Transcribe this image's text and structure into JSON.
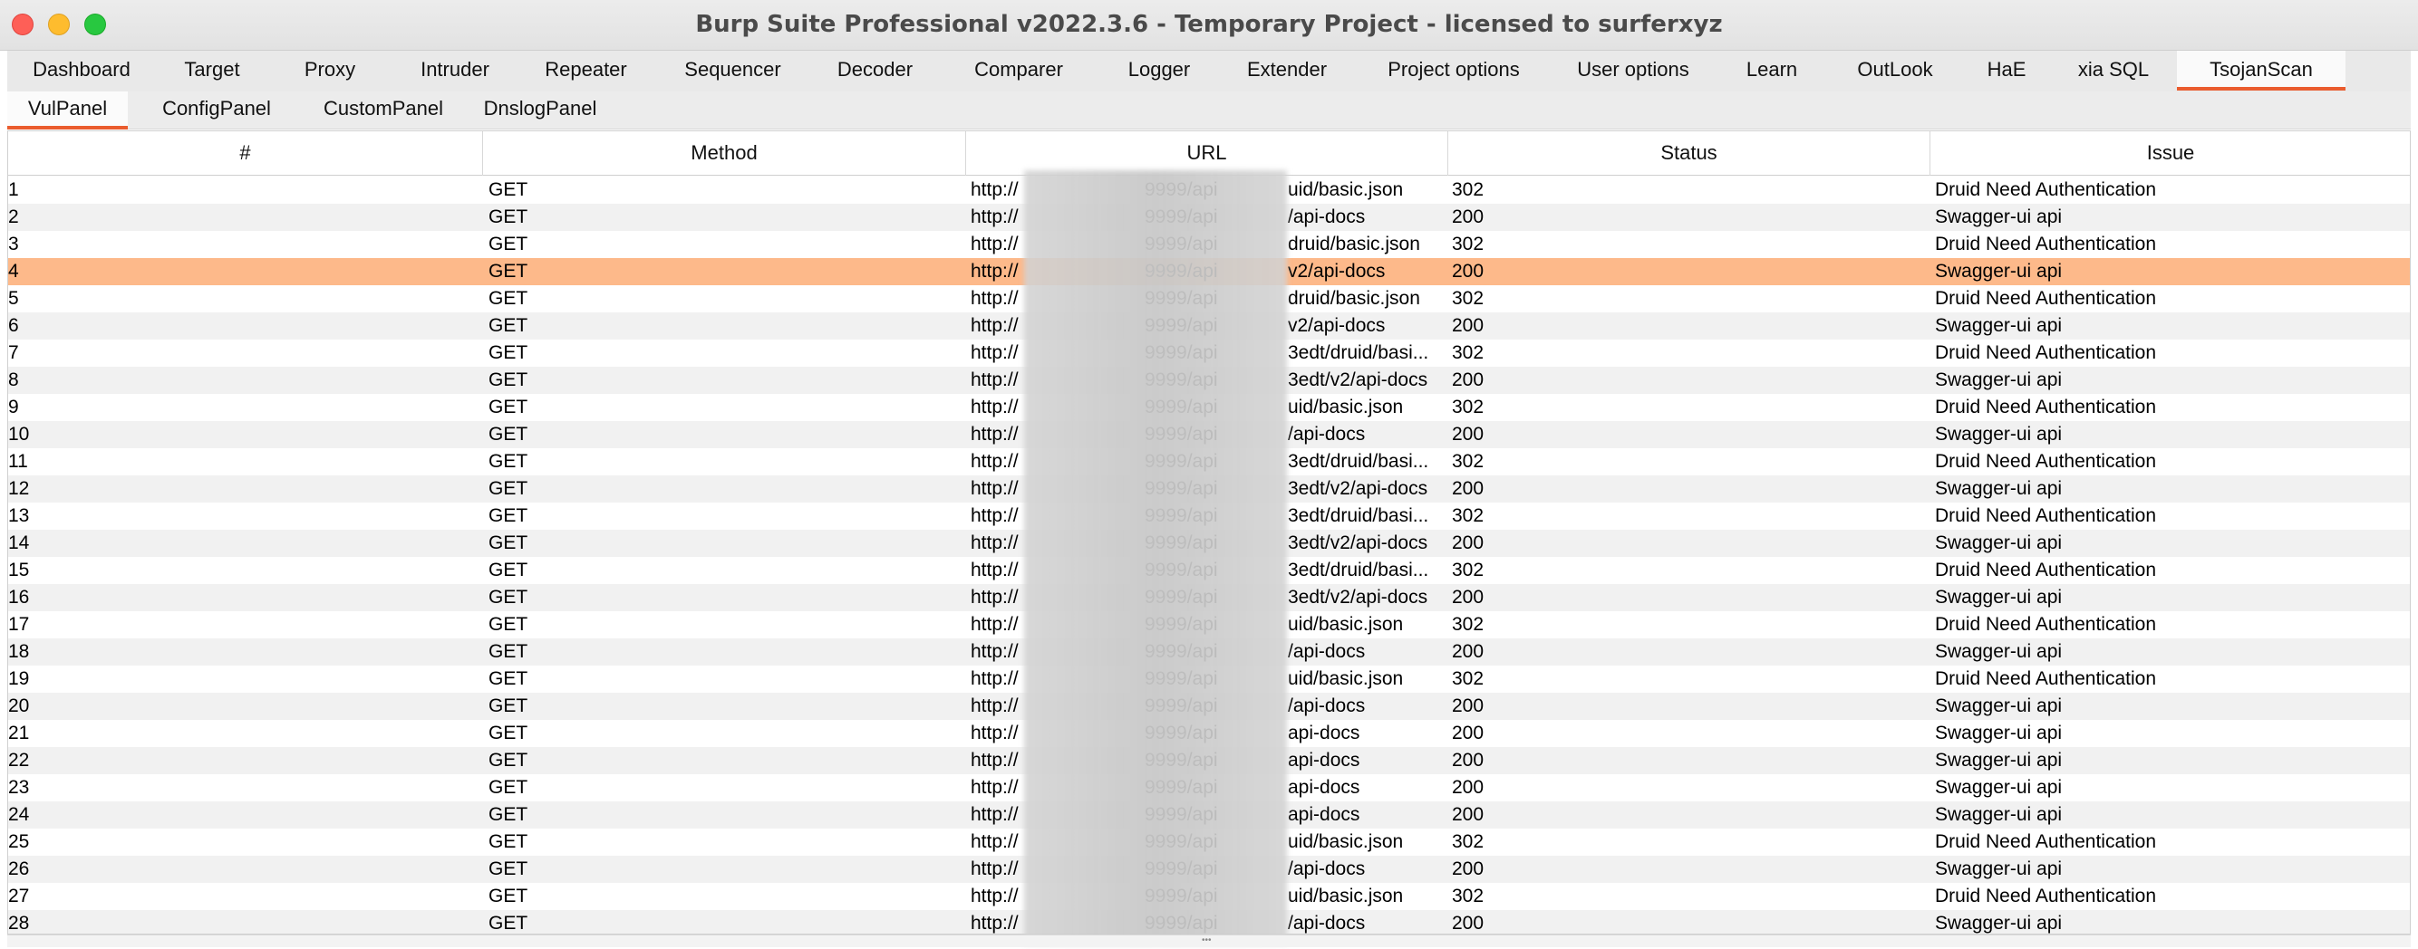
{
  "window": {
    "title": "Burp Suite Professional v2022.3.6 - Temporary Project - licensed to surferxyz"
  },
  "main_tabs": [
    {
      "label": "Dashboard"
    },
    {
      "label": "Target"
    },
    {
      "label": "Proxy"
    },
    {
      "label": "Intruder"
    },
    {
      "label": "Repeater"
    },
    {
      "label": "Sequencer"
    },
    {
      "label": "Decoder"
    },
    {
      "label": "Comparer"
    },
    {
      "label": "Logger"
    },
    {
      "label": "Extender"
    },
    {
      "label": "Project options"
    },
    {
      "label": "User options"
    },
    {
      "label": "Learn"
    },
    {
      "label": "OutLook"
    },
    {
      "label": "HaE"
    },
    {
      "label": "xia SQL"
    },
    {
      "label": "TsojanScan"
    }
  ],
  "active_main_tab": "TsojanScan",
  "sub_tabs": [
    {
      "label": "VulPanel"
    },
    {
      "label": "ConfigPanel"
    },
    {
      "label": "CustomPanel"
    },
    {
      "label": "DnslogPanel"
    }
  ],
  "active_sub_tab": "VulPanel",
  "colors": {
    "accent": "#ea5c2e",
    "selected_row": "#fdb98a"
  },
  "table": {
    "columns": [
      "#",
      "Method",
      "URL",
      "Status",
      "Issue"
    ],
    "selected_row": 4,
    "rows": [
      {
        "num": "1",
        "method": "GET",
        "url_prefix": "http://",
        "url_mid": "9999/api",
        "url_suffix": "uid/basic.json",
        "status": "302",
        "issue": "Druid Need Authentication"
      },
      {
        "num": "2",
        "method": "GET",
        "url_prefix": "http://",
        "url_mid": "9999/api",
        "url_suffix": "/api-docs",
        "status": "200",
        "issue": "Swagger-ui api"
      },
      {
        "num": "3",
        "method": "GET",
        "url_prefix": "http://",
        "url_mid": "9999/api",
        "url_suffix": "druid/basic.json",
        "status": "302",
        "issue": "Druid Need Authentication"
      },
      {
        "num": "4",
        "method": "GET",
        "url_prefix": "http://",
        "url_mid": "9999/api",
        "url_suffix": "v2/api-docs",
        "status": "200",
        "issue": "Swagger-ui api"
      },
      {
        "num": "5",
        "method": "GET",
        "url_prefix": "http://",
        "url_mid": "9999/api",
        "url_suffix": "druid/basic.json",
        "status": "302",
        "issue": "Druid Need Authentication"
      },
      {
        "num": "6",
        "method": "GET",
        "url_prefix": "http://",
        "url_mid": "9999/api",
        "url_suffix": "v2/api-docs",
        "status": "200",
        "issue": "Swagger-ui api"
      },
      {
        "num": "7",
        "method": "GET",
        "url_prefix": "http://",
        "url_mid": "9999/api",
        "url_suffix": "3edt/druid/basi...",
        "status": "302",
        "issue": "Druid Need Authentication"
      },
      {
        "num": "8",
        "method": "GET",
        "url_prefix": "http://",
        "url_mid": "9999/api",
        "url_suffix": "3edt/v2/api-docs",
        "status": "200",
        "issue": "Swagger-ui api"
      },
      {
        "num": "9",
        "method": "GET",
        "url_prefix": "http://",
        "url_mid": "9999/api",
        "url_suffix": "uid/basic.json",
        "status": "302",
        "issue": "Druid Need Authentication"
      },
      {
        "num": "10",
        "method": "GET",
        "url_prefix": "http://",
        "url_mid": "9999/api",
        "url_suffix": "/api-docs",
        "status": "200",
        "issue": "Swagger-ui api"
      },
      {
        "num": "11",
        "method": "GET",
        "url_prefix": "http://",
        "url_mid": "9999/api",
        "url_suffix": "3edt/druid/basi...",
        "status": "302",
        "issue": "Druid Need Authentication"
      },
      {
        "num": "12",
        "method": "GET",
        "url_prefix": "http://",
        "url_mid": "9999/api",
        "url_suffix": "3edt/v2/api-docs",
        "status": "200",
        "issue": "Swagger-ui api"
      },
      {
        "num": "13",
        "method": "GET",
        "url_prefix": "http://",
        "url_mid": "9999/api",
        "url_suffix": "3edt/druid/basi...",
        "status": "302",
        "issue": "Druid Need Authentication"
      },
      {
        "num": "14",
        "method": "GET",
        "url_prefix": "http://",
        "url_mid": "9999/api",
        "url_suffix": "3edt/v2/api-docs",
        "status": "200",
        "issue": "Swagger-ui api"
      },
      {
        "num": "15",
        "method": "GET",
        "url_prefix": "http://",
        "url_mid": "9999/api",
        "url_suffix": "3edt/druid/basi...",
        "status": "302",
        "issue": "Druid Need Authentication"
      },
      {
        "num": "16",
        "method": "GET",
        "url_prefix": "http://",
        "url_mid": "9999/api",
        "url_suffix": "3edt/v2/api-docs",
        "status": "200",
        "issue": "Swagger-ui api"
      },
      {
        "num": "17",
        "method": "GET",
        "url_prefix": "http://",
        "url_mid": "9999/api",
        "url_suffix": "uid/basic.json",
        "status": "302",
        "issue": "Druid Need Authentication"
      },
      {
        "num": "18",
        "method": "GET",
        "url_prefix": "http://",
        "url_mid": "9999/api",
        "url_suffix": "/api-docs",
        "status": "200",
        "issue": "Swagger-ui api"
      },
      {
        "num": "19",
        "method": "GET",
        "url_prefix": "http://",
        "url_mid": "9999/api",
        "url_suffix": "uid/basic.json",
        "status": "302",
        "issue": "Druid Need Authentication"
      },
      {
        "num": "20",
        "method": "GET",
        "url_prefix": "http://",
        "url_mid": "9999/api",
        "url_suffix": "/api-docs",
        "status": "200",
        "issue": "Swagger-ui api"
      },
      {
        "num": "21",
        "method": "GET",
        "url_prefix": "http://",
        "url_mid": "9999/api",
        "url_suffix": "api-docs",
        "status": "200",
        "issue": "Swagger-ui api"
      },
      {
        "num": "22",
        "method": "GET",
        "url_prefix": "http://",
        "url_mid": "9999/api",
        "url_suffix": "api-docs",
        "status": "200",
        "issue": "Swagger-ui api"
      },
      {
        "num": "23",
        "method": "GET",
        "url_prefix": "http://",
        "url_mid": "9999/api",
        "url_suffix": "api-docs",
        "status": "200",
        "issue": "Swagger-ui api"
      },
      {
        "num": "24",
        "method": "GET",
        "url_prefix": "http://",
        "url_mid": "9999/api",
        "url_suffix": "api-docs",
        "status": "200",
        "issue": "Swagger-ui api"
      },
      {
        "num": "25",
        "method": "GET",
        "url_prefix": "http://",
        "url_mid": "9999/api",
        "url_suffix": "uid/basic.json",
        "status": "302",
        "issue": "Druid Need Authentication"
      },
      {
        "num": "26",
        "method": "GET",
        "url_prefix": "http://",
        "url_mid": "9999/api",
        "url_suffix": "/api-docs",
        "status": "200",
        "issue": "Swagger-ui api"
      },
      {
        "num": "27",
        "method": "GET",
        "url_prefix": "http://",
        "url_mid": "9999/api",
        "url_suffix": "uid/basic.json",
        "status": "302",
        "issue": "Druid Need Authentication"
      },
      {
        "num": "28",
        "method": "GET",
        "url_prefix": "http://",
        "url_mid": "9999/api",
        "url_suffix": "/api-docs",
        "status": "200",
        "issue": "Swagger-ui api"
      }
    ]
  }
}
